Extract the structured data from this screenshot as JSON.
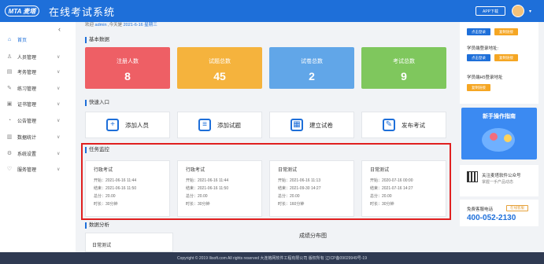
{
  "header": {
    "logo": "MTA 麦塔",
    "title": "在线考试系统",
    "app_download": "APP下载",
    "avatar_caret": "▾"
  },
  "sidebar": {
    "collapse": "‹",
    "items": [
      {
        "label": "首页",
        "icon": "home-icon",
        "glyph": "⌂"
      },
      {
        "label": "人员管理",
        "icon": "user-icon",
        "glyph": "♙"
      },
      {
        "label": "考务管理",
        "icon": "file-icon",
        "glyph": "▤"
      },
      {
        "label": "练习管理",
        "icon": "edit-icon",
        "glyph": "✎"
      },
      {
        "label": "证书管理",
        "icon": "certificate-icon",
        "glyph": "▣"
      },
      {
        "label": "公告管理",
        "icon": "bell-icon",
        "glyph": "◔"
      },
      {
        "label": "数据统计",
        "icon": "chart-icon",
        "glyph": "▥"
      },
      {
        "label": "系统设置",
        "icon": "gear-icon",
        "glyph": "⚙"
      },
      {
        "label": "服务管理",
        "icon": "heart-icon",
        "glyph": "♡"
      }
    ]
  },
  "welcome": {
    "prefix": "欢迎",
    "user": "admin",
    "today_label": ",今天是",
    "date": "2021-6-16",
    "weekday": "星期三"
  },
  "sections": {
    "basic": "基本数据",
    "quick": "快速入口",
    "tasks": "任务监控",
    "analysis": "数据分析"
  },
  "stats": [
    {
      "label": "注册人数",
      "value": "8",
      "color": "#ee5f65"
    },
    {
      "label": "试题总数",
      "value": "45",
      "color": "#f5b33d"
    },
    {
      "label": "试卷总数",
      "value": "2",
      "color": "#61a6e8"
    },
    {
      "label": "考试总数",
      "value": "9",
      "color": "#7fc75d"
    }
  ],
  "quick": [
    {
      "label": "添加人员",
      "icon": "add-user-icon",
      "glyph": "+"
    },
    {
      "label": "添加试题",
      "icon": "add-question-icon",
      "glyph": "≡"
    },
    {
      "label": "建立试卷",
      "icon": "create-paper-icon",
      "glyph": "▦"
    },
    {
      "label": "发布考试",
      "icon": "publish-icon",
      "glyph": "✎"
    }
  ],
  "tasks": [
    {
      "title": "行政考试",
      "start": "开始：2021-06-16 11:44",
      "end": "结束：2021-06-16 11:50",
      "score": "总分：20.00",
      "duration": "时长：30分钟"
    },
    {
      "title": "行政考试",
      "start": "开始：2021-06-16 11:44",
      "end": "结束：2021-06-16 11:50",
      "score": "总分：20.00",
      "duration": "时长：30分钟"
    },
    {
      "title": "日常测试",
      "start": "开始：2021-06-16 11:13",
      "end": "结束：2021-09-30 14:27",
      "score": "总分：20.00",
      "duration": "时长：160分钟"
    },
    {
      "title": "日常测试",
      "start": "开始：2020-07-16 00:00",
      "end": "结束：2021-07-16 14:27",
      "score": "总分：20.00",
      "duration": "时长：30分钟"
    }
  ],
  "analysis": {
    "item": "日常测试",
    "chart_title": "成绩分布图"
  },
  "right": {
    "btn_login": "点击登录",
    "btn_copy": "复制链接",
    "student_login": "学员端登录地址:",
    "btn_login2": "点击登录",
    "btn_copy2": "复制链接",
    "student_h5": "学员端H5登录地址",
    "btn_copy3": "复制链接",
    "guide_title": "新手操作指南",
    "follow_line1": "关注麦塔软件公众号",
    "follow_line2": "掌握一手产品动态",
    "hotline_label": "免费客服电话",
    "online_badge": "在线客服",
    "phone": "400-052-2130"
  },
  "footer": {
    "copyright": "Copyright © 2019 Ilisoft.com All rights reserved 大连格网软件工程有限公司 版权所有 辽ICP备09029949号-19"
  }
}
